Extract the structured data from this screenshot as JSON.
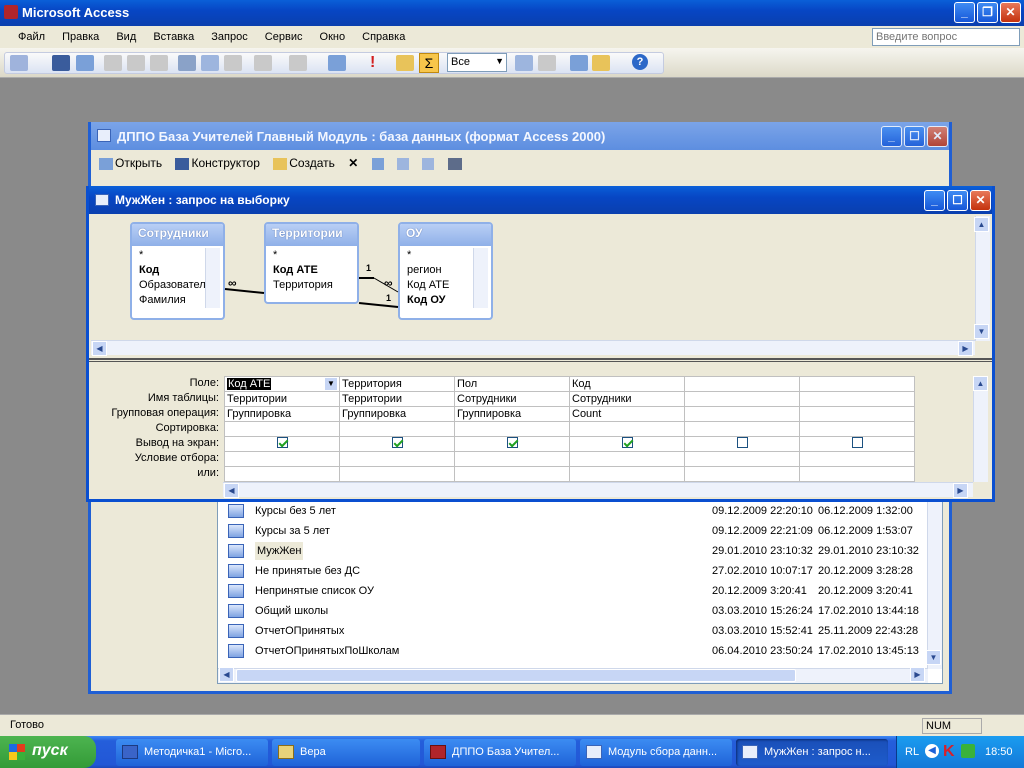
{
  "app": {
    "title": "Microsoft Access"
  },
  "menu": [
    "Файл",
    "Правка",
    "Вид",
    "Вставка",
    "Запрос",
    "Сервис",
    "Окно",
    "Справка"
  ],
  "help_box": {
    "placeholder": "Введите вопрос"
  },
  "toolbar": {
    "top_values": "Все"
  },
  "db_window": {
    "title": "ДППО База Учителей Главный Модуль  : база данных (формат Access 2000)",
    "open": "Открыть",
    "design": "Конструктор",
    "create": "Создать"
  },
  "query_window": {
    "title": "МужЖен : запрос на выборку"
  },
  "tables": [
    {
      "name": "Сотрудники",
      "fields": [
        "*",
        "Код",
        "Образовател",
        "Фамилия"
      ]
    },
    {
      "name": "Территории",
      "fields": [
        "*",
        "Код АТЕ",
        "Территория"
      ]
    },
    {
      "name": "ОУ",
      "fields": [
        "*",
        "регион",
        "Код АТЕ",
        "Код ОУ"
      ]
    }
  ],
  "joins": {
    "one": "1",
    "many": "∞"
  },
  "grid": {
    "labels": [
      "Поле:",
      "Имя таблицы:",
      "Групповая операция:",
      "Сортировка:",
      "Вывод на экран:",
      "Условие отбора:",
      "или:"
    ],
    "columns": [
      {
        "field": "Код АТЕ",
        "table": "Территории",
        "group": "Группировка",
        "show": true
      },
      {
        "field": "Территория",
        "table": "Территории",
        "group": "Группировка",
        "show": true
      },
      {
        "field": "Пол",
        "table": "Сотрудники",
        "group": "Группировка",
        "show": true
      },
      {
        "field": "Код",
        "table": "Сотрудники",
        "group": "Count",
        "show": true
      },
      {
        "field": "",
        "table": "",
        "group": "",
        "show": false
      },
      {
        "field": "",
        "table": "",
        "group": "",
        "show": false
      }
    ]
  },
  "queries": [
    {
      "name": "Курсы без 5 лет",
      "modified": "09.12.2009 22:20:10",
      "created": "06.12.2009 1:32:00"
    },
    {
      "name": "Курсы за 5 лет",
      "modified": "09.12.2009 22:21:09",
      "created": "06.12.2009 1:53:07"
    },
    {
      "name": "МужЖен",
      "modified": "29.01.2010 23:10:32",
      "created": "29.01.2010 23:10:32"
    },
    {
      "name": "Не принятые без ДС",
      "modified": "27.02.2010 10:07:17",
      "created": "20.12.2009 3:28:28"
    },
    {
      "name": "Непринятые список ОУ",
      "modified": "20.12.2009 3:20:41",
      "created": "20.12.2009 3:20:41"
    },
    {
      "name": "Общий школы",
      "modified": "03.03.2010 15:26:24",
      "created": "17.02.2010 13:44:18"
    },
    {
      "name": "ОтчетОПринятых",
      "modified": "03.03.2010 15:52:41",
      "created": "25.11.2009 22:43:28"
    },
    {
      "name": "ОтчетОПринятыхПоШколам",
      "modified": "06.04.2010 23:50:24",
      "created": "17.02.2010 13:45:13"
    }
  ],
  "status": {
    "left": "Готово",
    "num": "NUM"
  },
  "taskbar": {
    "start": "пуск",
    "items": [
      "Методичка1 - Micro...",
      "Вера",
      "ДППО База Учител...",
      "Модуль сбора данн...",
      "МужЖен : запрос н..."
    ],
    "lang": "RL",
    "clock": "18:50"
  }
}
